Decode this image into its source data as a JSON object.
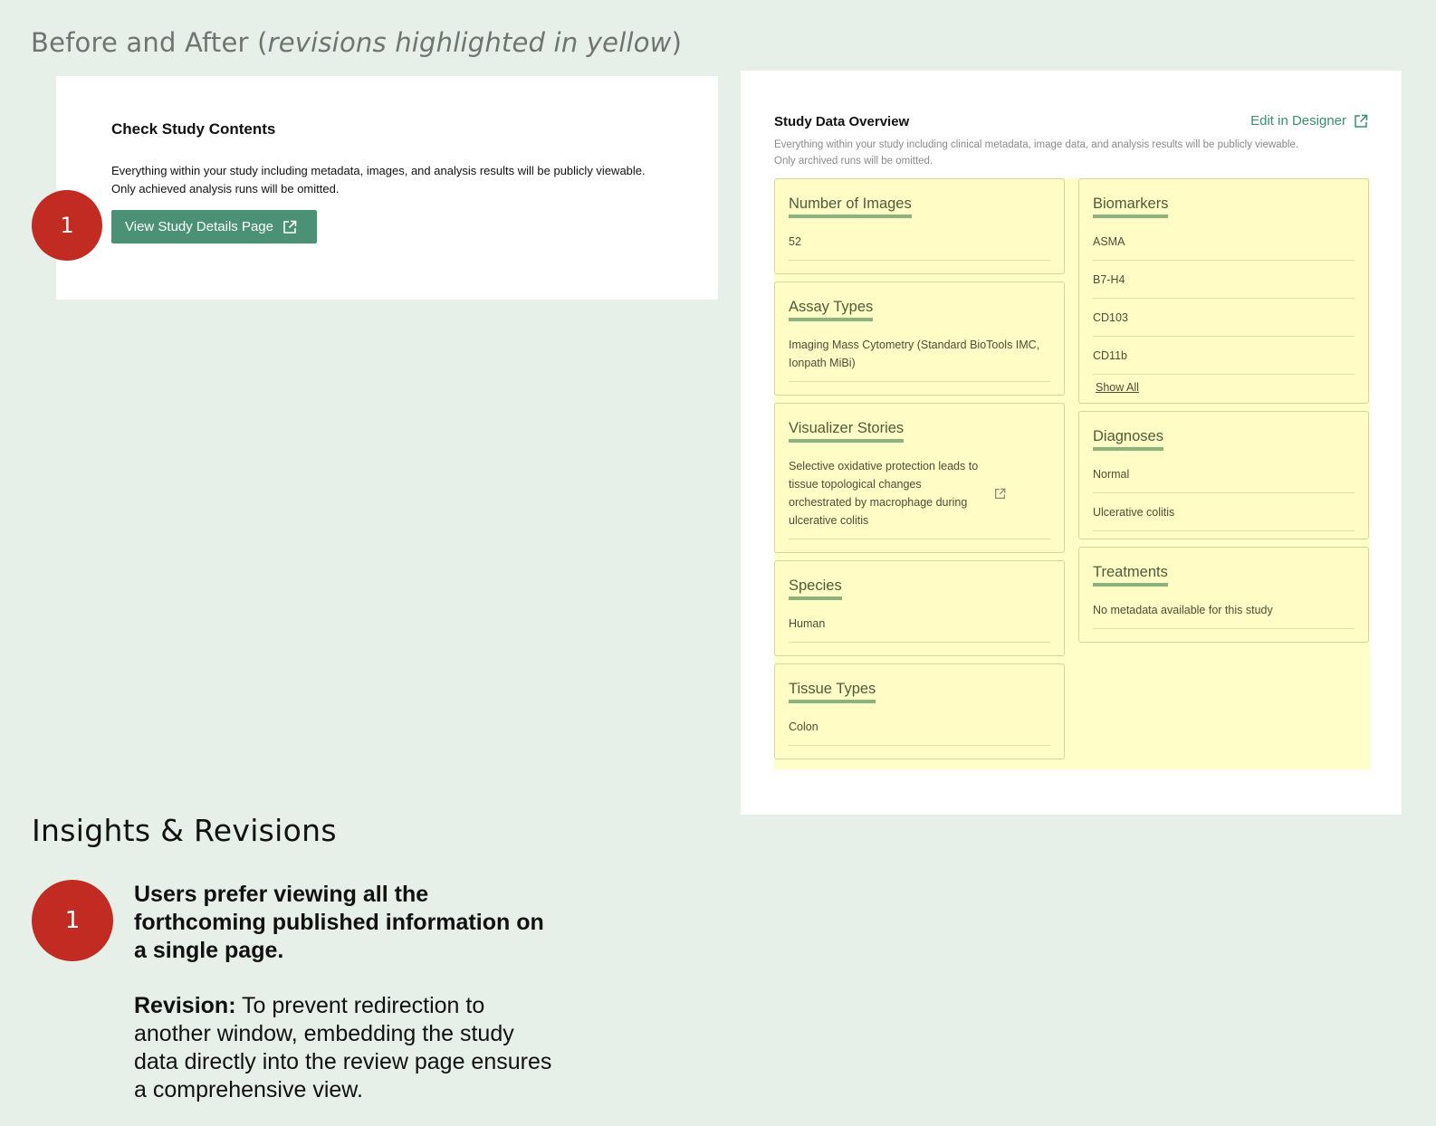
{
  "heading": {
    "prefix": "Before and After (",
    "emphasis": "revisions highlighted in yellow",
    "suffix": ")"
  },
  "before": {
    "title": "Check Study Contents",
    "desc_lines": [
      "Everything within your study including metadata, images, and analysis results will be publicly viewable.",
      "Only achieved analysis runs will be omitted."
    ],
    "button_label": "View Study Details Page",
    "button_icon": "external-link-icon"
  },
  "badge_number": "1",
  "after": {
    "title": "Study Data Overview",
    "edit_label": "Edit in Designer",
    "edit_icon": "external-link-icon",
    "desc_lines": [
      "Everything within your study including clinical metadata, image data, and analysis results will be publicly viewable.",
      "Only archived runs will be omitted."
    ],
    "panels_left": [
      {
        "title": "Number of Images",
        "items": [
          "52"
        ]
      },
      {
        "title": "Assay Types",
        "items": [
          "Imaging Mass Cytometry (Standard BioTools IMC, Ionpath MiBi)"
        ]
      },
      {
        "title": "Visualizer Stories",
        "items": [
          "Selective oxidative protection leads to tissue topological changes orchestrated by macrophage during ulcerative colitis"
        ]
      },
      {
        "title": "Species",
        "items": [
          "Human"
        ]
      },
      {
        "title": "Tissue Types",
        "items": [
          "Colon"
        ]
      }
    ],
    "panels_right": [
      {
        "title": "Biomarkers",
        "items": [
          "ASMA",
          "B7-H4",
          "CD103",
          "CD11b"
        ],
        "show_all": "Show All"
      },
      {
        "title": "Diagnoses",
        "items": [
          "Normal",
          "Ulcerative colitis"
        ]
      },
      {
        "title": "Treatments",
        "items": [
          "No metadata available for this study"
        ]
      }
    ]
  },
  "insights": {
    "title": "Insights & Revisions",
    "headline_lines": [
      "Users prefer viewing all the",
      "forthcoming published information on",
      "a single page."
    ],
    "revision_label": "Revision:",
    "revision_lines": [
      " To prevent redirection to",
      "another window, embedding the study",
      "data directly into the review page ensures",
      "a comprehensive view."
    ]
  },
  "colors": {
    "badge": "#c12b22",
    "button": "#4a9176",
    "highlight": "#fffdc8",
    "underline": "#8cb27d"
  }
}
